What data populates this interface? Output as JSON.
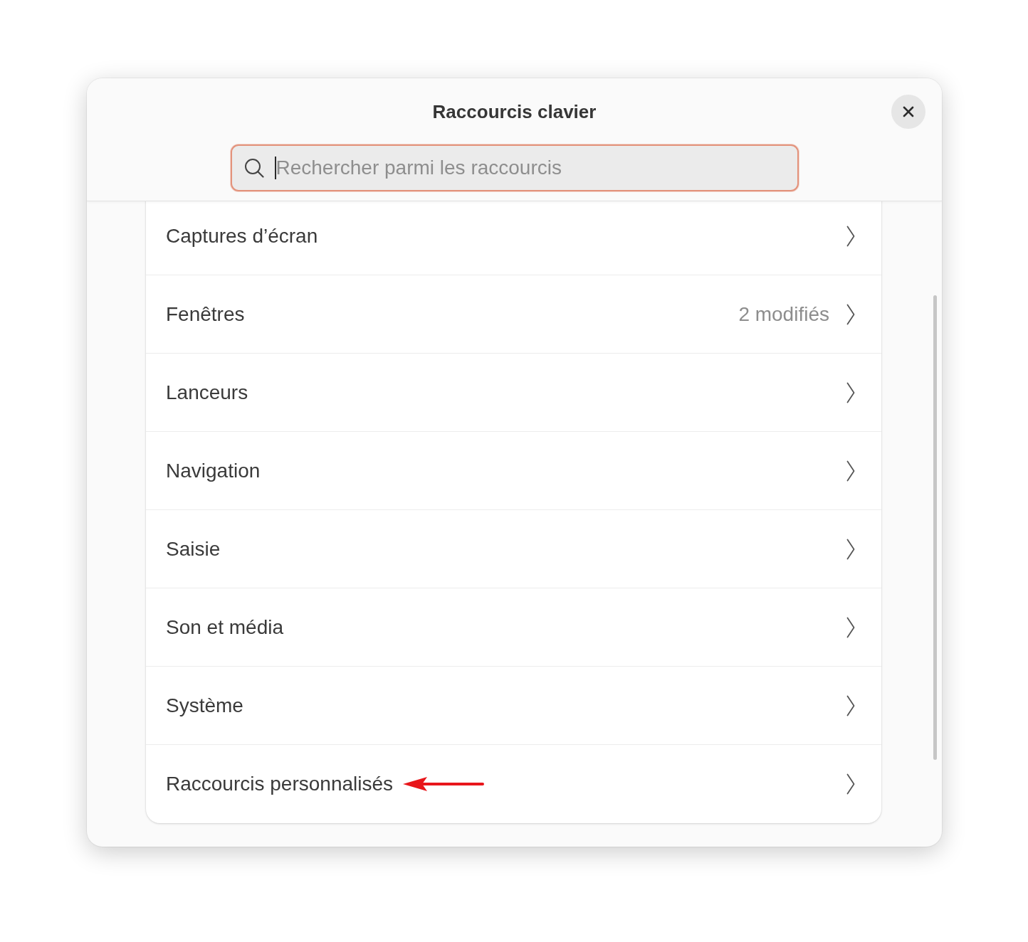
{
  "dialog": {
    "title": "Raccourcis clavier"
  },
  "search": {
    "placeholder": "Rechercher parmi les raccourcis",
    "focused": true
  },
  "categories": [
    {
      "label": "Captures d’écran",
      "arrow": false
    },
    {
      "label": "Fenêtres",
      "value": "2 modifiés",
      "arrow": false
    },
    {
      "label": "Lanceurs",
      "arrow": false
    },
    {
      "label": "Navigation",
      "arrow": false
    },
    {
      "label": "Saisie",
      "arrow": false
    },
    {
      "label": "Son et média",
      "arrow": false
    },
    {
      "label": "Système",
      "arrow": false
    },
    {
      "label": "Raccourcis personnalisés",
      "arrow": true
    }
  ]
}
